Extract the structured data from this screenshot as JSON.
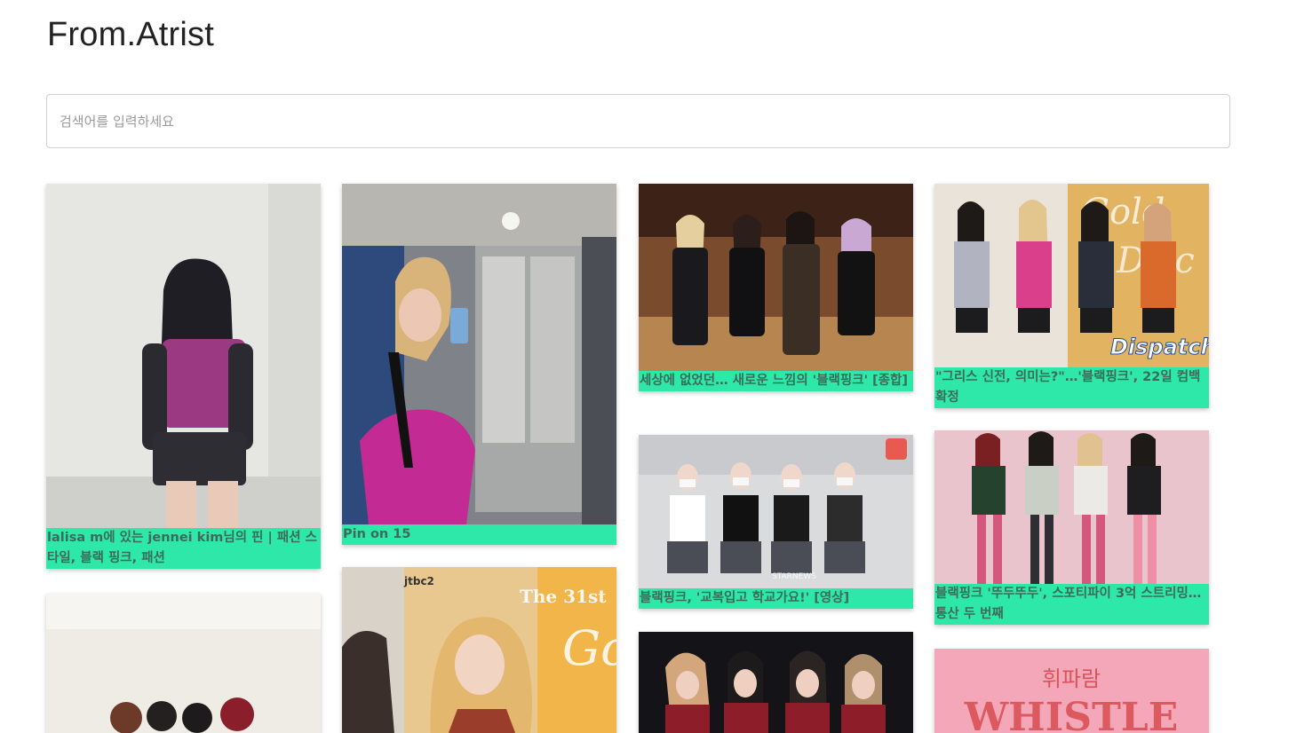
{
  "app": {
    "title": "From.Atrist"
  },
  "search": {
    "placeholder": "검색어를 입력하세요",
    "value": ""
  },
  "cards": [
    {
      "caption": "lalisa m에 있는 jennei kim님의 핀 | 패션 스타일, 블랙 핑크, 패션"
    },
    {
      "caption": "Pin on 15"
    },
    {
      "caption": "세상에 없었던… 새로운 느낌의 '블랙핑크' [종합]"
    },
    {
      "caption": "\"그리스 신전, 의미는?\"…'블랙핑크', 22일 컴백 확정"
    },
    {
      "caption": "블랙핑크, '교복입고 학교가요!' [영상]"
    },
    {
      "caption": "블랙핑크 '뚜두뚜두', 스포티파이 3억 스트리밍…통산 두 번째"
    },
    {
      "caption": ""
    },
    {
      "caption": ""
    },
    {
      "caption": ""
    },
    {
      "caption": ""
    }
  ],
  "image_text": {
    "dispatch": "Dispatch",
    "the31st": "The 31st",
    "jtbc": "jtbc2",
    "whistle_ko": "휘파람",
    "whistle": "WHISTLE",
    "starnews": "STARNEWS"
  }
}
